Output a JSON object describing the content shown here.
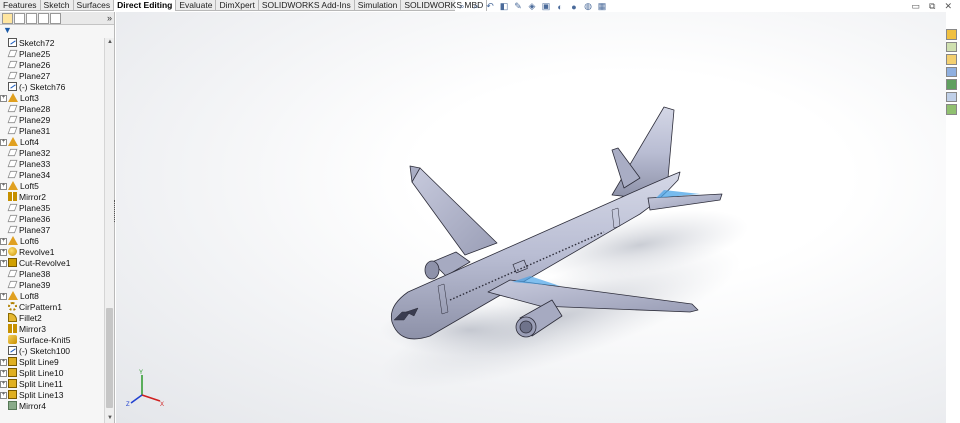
{
  "command_tabs": [
    {
      "label": "Features",
      "active": false
    },
    {
      "label": "Sketch",
      "active": false
    },
    {
      "label": "Surfaces",
      "active": false
    },
    {
      "label": "Direct Editing",
      "active": true
    },
    {
      "label": "Evaluate",
      "active": false
    },
    {
      "label": "DimXpert",
      "active": false
    },
    {
      "label": "SOLIDWORKS Add-Ins",
      "active": false
    },
    {
      "label": "Simulation",
      "active": false
    },
    {
      "label": "SOLIDWORKS MBD",
      "active": false
    }
  ],
  "hud_icons": [
    "zoom-to-fit-icon",
    "zoom-area-icon",
    "previous-view-icon",
    "section-view-icon",
    "dynamic-annotation-icon",
    "view-orientation-icon",
    "display-style-icon",
    "hide-show-icon",
    "edit-appearance-icon",
    "scene-icon",
    "view-settings-icon"
  ],
  "window_controls": {
    "minimize": "▭",
    "restore": "⧉",
    "close": "✕"
  },
  "panel": {
    "tabs": [
      "featuremanager-icon",
      "propertymanager-icon",
      "configurationmanager-icon",
      "dimxpert-icon",
      "display-manager-icon"
    ],
    "more": "»",
    "filter": "▼"
  },
  "tree": [
    {
      "label": "Sketch72",
      "icon": "sketch",
      "expandable": false
    },
    {
      "label": "Plane25",
      "icon": "plane",
      "expandable": false
    },
    {
      "label": "Plane26",
      "icon": "plane",
      "expandable": false
    },
    {
      "label": "Plane27",
      "icon": "plane",
      "expandable": false
    },
    {
      "label": "(-) Sketch76",
      "icon": "sketch",
      "expandable": false
    },
    {
      "label": "Loft3",
      "icon": "loft",
      "expandable": true
    },
    {
      "label": "Plane28",
      "icon": "plane",
      "expandable": false
    },
    {
      "label": "Plane29",
      "icon": "plane",
      "expandable": false
    },
    {
      "label": "Plane31",
      "icon": "plane",
      "expandable": false
    },
    {
      "label": "Loft4",
      "icon": "loft",
      "expandable": true
    },
    {
      "label": "Plane32",
      "icon": "plane",
      "expandable": false
    },
    {
      "label": "Plane33",
      "icon": "plane",
      "expandable": false
    },
    {
      "label": "Plane34",
      "icon": "plane",
      "expandable": false
    },
    {
      "label": "Loft5",
      "icon": "loft",
      "expandable": true
    },
    {
      "label": "Mirror2",
      "icon": "mirror",
      "expandable": false
    },
    {
      "label": "Plane35",
      "icon": "plane",
      "expandable": false
    },
    {
      "label": "Plane36",
      "icon": "plane",
      "expandable": false
    },
    {
      "label": "Plane37",
      "icon": "plane",
      "expandable": false
    },
    {
      "label": "Loft6",
      "icon": "loft",
      "expandable": true
    },
    {
      "label": "Revolve1",
      "icon": "revolve",
      "expandable": true
    },
    {
      "label": "Cut-Revolve1",
      "icon": "cut",
      "expandable": true
    },
    {
      "label": "Plane38",
      "icon": "plane",
      "expandable": false
    },
    {
      "label": "Plane39",
      "icon": "plane",
      "expandable": false
    },
    {
      "label": "Loft8",
      "icon": "loft",
      "expandable": true
    },
    {
      "label": "CirPattern1",
      "icon": "pattern",
      "expandable": false
    },
    {
      "label": "Fillet2",
      "icon": "fillet",
      "expandable": false
    },
    {
      "label": "Mirror3",
      "icon": "mirror",
      "expandable": false
    },
    {
      "label": "Surface-Knit5",
      "icon": "surf",
      "expandable": false
    },
    {
      "label": "(-) Sketch100",
      "icon": "sketch",
      "expandable": false
    },
    {
      "label": "Split Line9",
      "icon": "split",
      "expandable": true
    },
    {
      "label": "Split Line10",
      "icon": "split",
      "expandable": true
    },
    {
      "label": "Split Line11",
      "icon": "split",
      "expandable": true
    },
    {
      "label": "Split Line13",
      "icon": "split",
      "expandable": true
    },
    {
      "label": "Mirror4",
      "icon": "mirror4",
      "expandable": false
    }
  ],
  "scrollbar": {
    "up": "▲",
    "down": "▼"
  },
  "triad": {
    "x": "X",
    "y": "Y",
    "z": "Z"
  },
  "task_pane": [
    "solidworks-resources-icon",
    "design-library-icon",
    "file-explorer-icon",
    "view-palette-icon",
    "appearances-icon",
    "custom-properties-icon",
    "forum-icon"
  ],
  "colors": {
    "model": "#b9bdd3",
    "model_edge": "#2d2d3a",
    "accent": "#4aa4e8",
    "viewport_bg": "#ffffff"
  }
}
